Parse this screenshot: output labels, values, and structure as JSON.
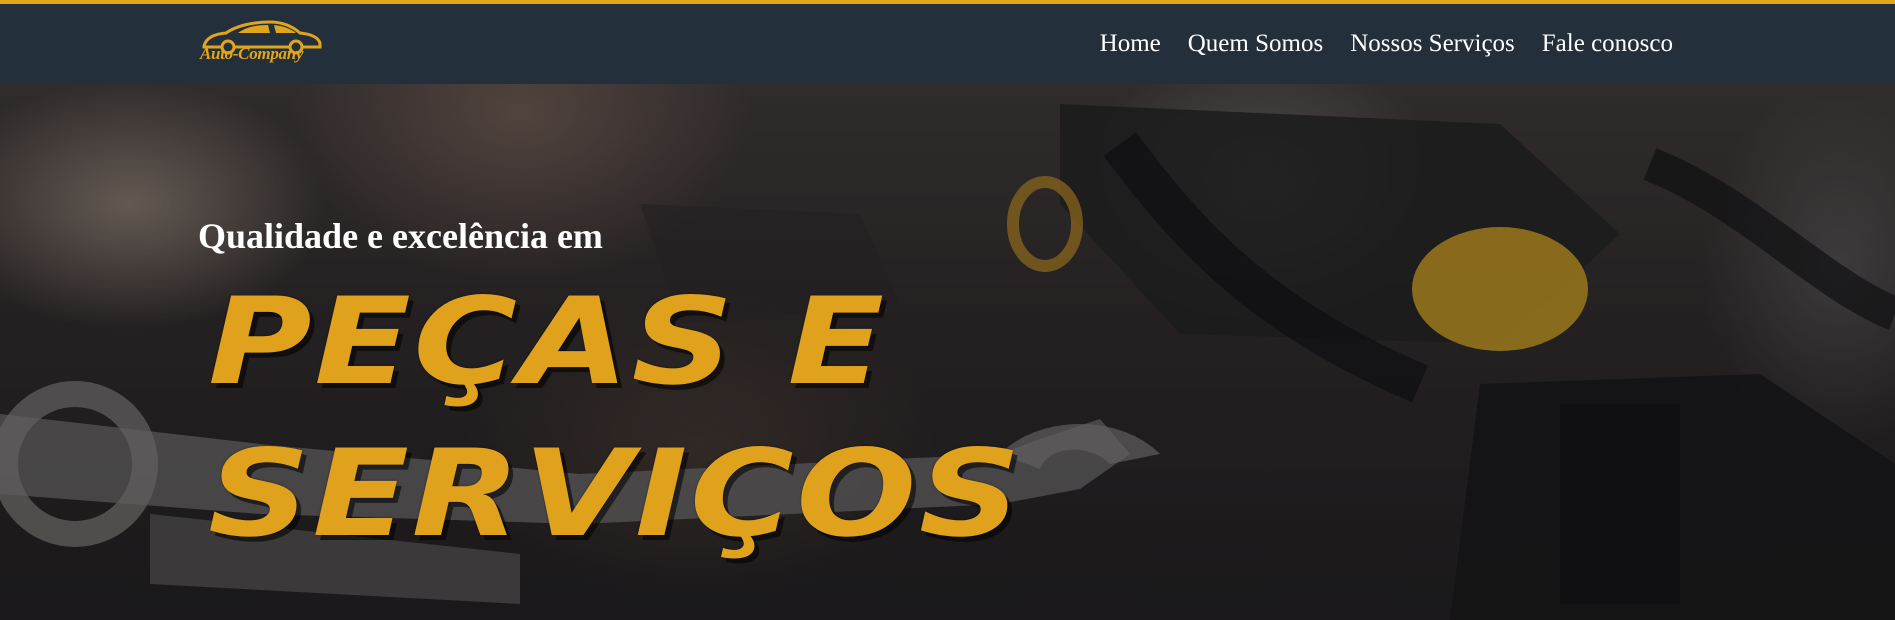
{
  "navbar": {
    "logo_text": "Auto-Company",
    "links": [
      {
        "label": "Home"
      },
      {
        "label": "Quem Somos"
      },
      {
        "label": "Nossos Serviços"
      },
      {
        "label": "Fale conosco"
      }
    ]
  },
  "hero": {
    "subtitle": "Qualidade e excelência em",
    "headline_line1": "PEÇAS E",
    "headline_line2": "SERVIÇOS"
  },
  "colors": {
    "accent": "#e1a51b",
    "navbar_bg": "#232f3b",
    "headline": "#e0a21c"
  },
  "icons": {
    "logo": "car-icon"
  }
}
